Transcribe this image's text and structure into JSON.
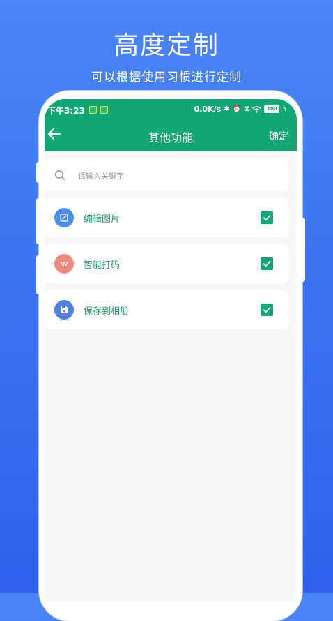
{
  "promo": {
    "title": "高度定制",
    "subtitle": "可以根据使用习惯进行定制"
  },
  "status_bar": {
    "time": "下午3:23",
    "network_speed": "0.0K/s",
    "battery": "100"
  },
  "header": {
    "title": "其他功能",
    "confirm_label": "确定"
  },
  "search": {
    "placeholder": "请输入关键字",
    "value": ""
  },
  "items": [
    {
      "label": "编辑图片",
      "icon": "edit-icon",
      "icon_color": "#4a8ff0",
      "checked": true
    },
    {
      "label": "智能打码",
      "icon": "mosaic-icon",
      "icon_color": "#f08a80",
      "checked": true
    },
    {
      "label": "保存到相册",
      "icon": "save-icon",
      "icon_color": "#4f7fdf",
      "checked": true
    }
  ],
  "colors": {
    "accent": "#13a676",
    "background_blue": "#3a70f0"
  }
}
